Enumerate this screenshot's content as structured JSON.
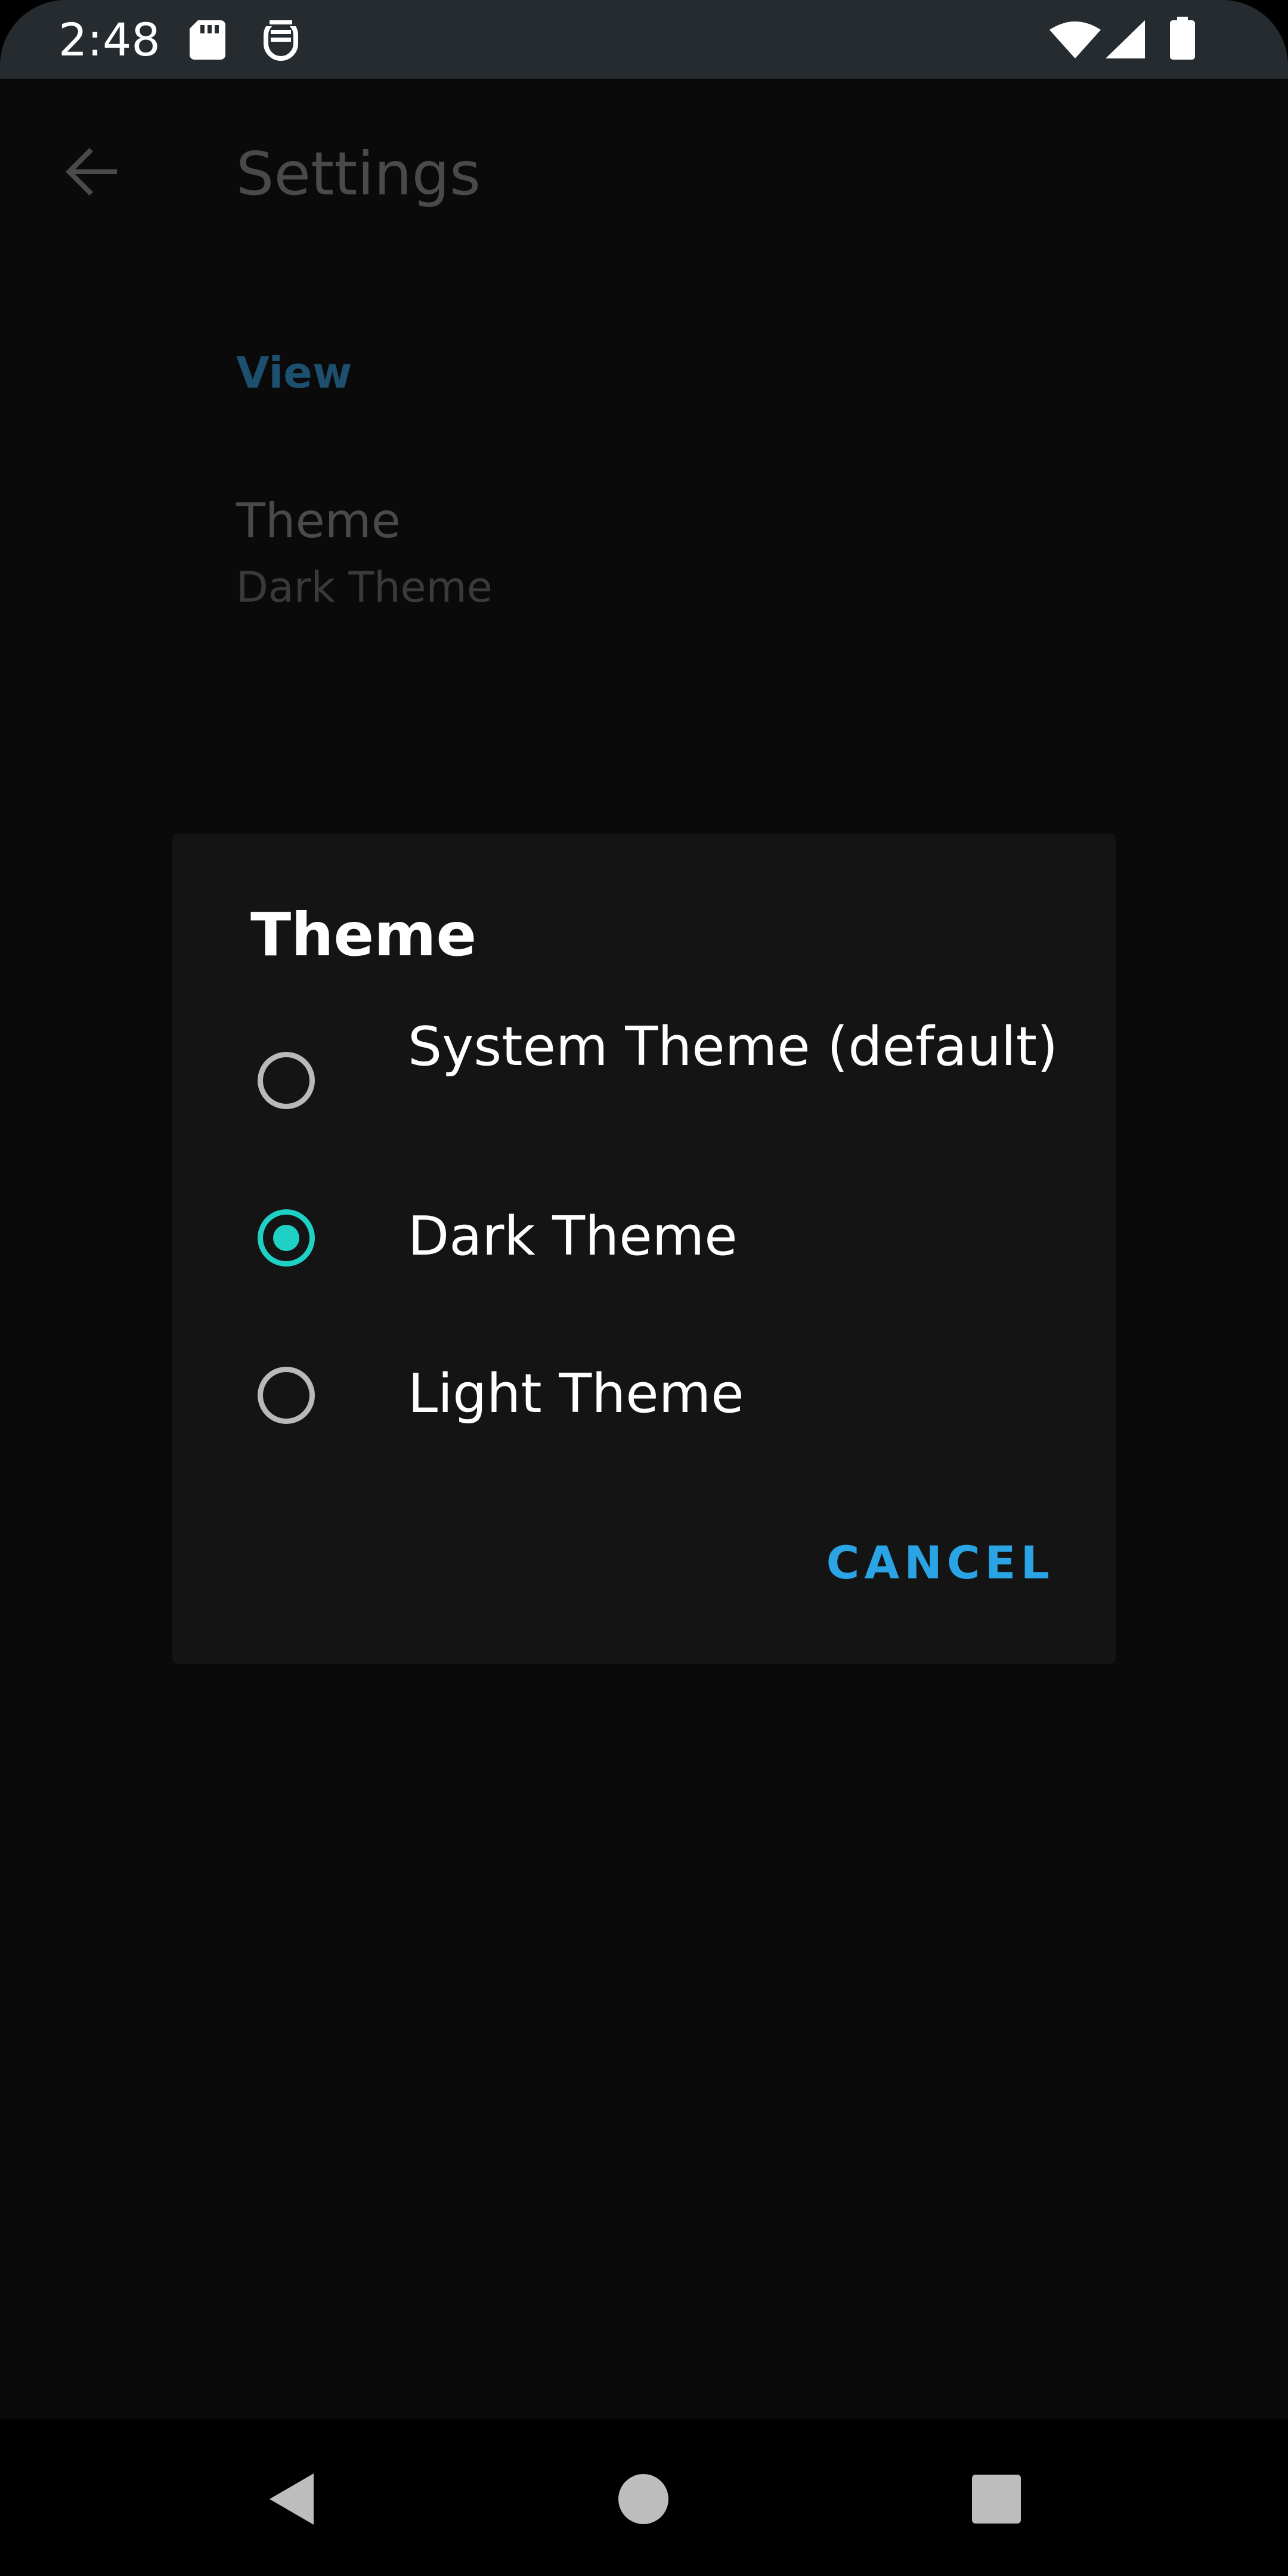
{
  "status_bar": {
    "time": "2:48",
    "icons": [
      "sd-card-icon",
      "notification-app-icon",
      "wifi-icon",
      "cell-signal-icon",
      "battery-icon"
    ]
  },
  "app_bar": {
    "back_icon": "arrow-back-icon",
    "title": "Settings"
  },
  "settings": {
    "section_header": "View",
    "theme_pref": {
      "title": "Theme",
      "summary": "Dark Theme"
    }
  },
  "dialog": {
    "title": "Theme",
    "options": [
      {
        "label": "System Theme (default)",
        "selected": false
      },
      {
        "label": "Dark Theme",
        "selected": true
      },
      {
        "label": "Light Theme",
        "selected": false
      }
    ],
    "cancel_label": "CANCEL"
  },
  "nav_bar": {
    "icons": [
      "nav-back-icon",
      "nav-home-icon",
      "nav-recents-icon"
    ]
  },
  "colors": {
    "accent": "#1fd1c4",
    "button": "#2aa4e4",
    "section_header": "#1d4f6e",
    "status_bar": "#262b2f",
    "dialog_bg": "#141414"
  }
}
